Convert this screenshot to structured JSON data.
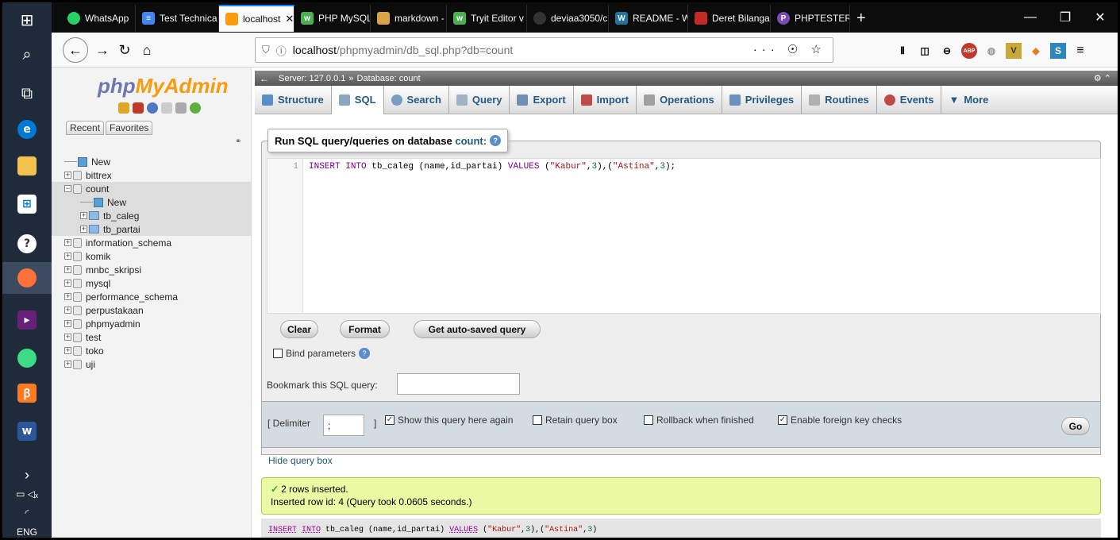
{
  "browser": {
    "tabs": [
      {
        "label": "WhatsApp",
        "icon": "whatsapp-icon",
        "color": "#25d366"
      },
      {
        "label": "Test Technica",
        "icon": "docs-icon",
        "color": "#4285f4"
      },
      {
        "label": "localhost",
        "icon": "phpmyadmin-icon",
        "color": "#f89c0e",
        "close": "✕"
      },
      {
        "label": "PHP MySQL",
        "icon": "w3schools-icon",
        "color": "#4caf50"
      },
      {
        "label": "markdown -",
        "icon": "document-icon",
        "color": "#d9a441"
      },
      {
        "label": "Tryit Editor v",
        "icon": "w3schools-icon",
        "color": "#4caf50"
      },
      {
        "label": "deviaa3050/c",
        "icon": "github-icon",
        "color": "#333333"
      },
      {
        "label": "README - W",
        "icon": "wordpress-icon",
        "color": "#21759b"
      },
      {
        "label": "Deret Bilanga",
        "icon": "site-icon",
        "color": "#c62828"
      },
      {
        "label": "PHPTESTER",
        "icon": "phptester-icon",
        "color": "#7b4bb5"
      }
    ],
    "new_tab": "+",
    "url_host": "localhost",
    "url_path": "/phpmyadmin/db_sql.php?db=count",
    "url_actions": "··· ☉ ☆",
    "window_controls": [
      "—",
      "❐",
      "✕"
    ]
  },
  "taskbar": {
    "apps": [
      "windows-start-icon",
      "search-icon",
      "task-view-icon",
      "edge-icon",
      "file-explorer-icon",
      "store-icon",
      "postman-icon",
      "firefox-icon",
      "visual-studio-icon",
      "android-studio-icon",
      "xampp-icon",
      "word-icon"
    ],
    "tray": {
      "arrow": "›",
      "lang": "ENG"
    }
  },
  "sidebar": {
    "logo_main": "php",
    "logo_accent": "MyAdmin",
    "tabs": [
      "Recent",
      "Favorites"
    ],
    "tree": [
      {
        "label": "New",
        "type": "new",
        "level": 0
      },
      {
        "label": "bittrex",
        "type": "db",
        "level": 0
      },
      {
        "label": "count",
        "type": "db",
        "level": 0,
        "expanded": true
      },
      {
        "label": "New",
        "type": "new",
        "level": 1
      },
      {
        "label": "tb_caleg",
        "type": "table",
        "level": 1
      },
      {
        "label": "tb_partai",
        "type": "table",
        "level": 1
      },
      {
        "label": "information_schema",
        "type": "db",
        "level": 0
      },
      {
        "label": "komik",
        "type": "db",
        "level": 0
      },
      {
        "label": "mnbc_skripsi",
        "type": "db",
        "level": 0
      },
      {
        "label": "mysql",
        "type": "db",
        "level": 0
      },
      {
        "label": "performance_schema",
        "type": "db",
        "level": 0
      },
      {
        "label": "perpustakaan",
        "type": "db",
        "level": 0
      },
      {
        "label": "phpmyadmin",
        "type": "db",
        "level": 0
      },
      {
        "label": "test",
        "type": "db",
        "level": 0
      },
      {
        "label": "toko",
        "type": "db",
        "level": 0
      },
      {
        "label": "uji",
        "type": "db",
        "level": 0
      }
    ]
  },
  "breadcrumb": {
    "server": "Server: 127.0.0.1",
    "sep": "»",
    "database": "Database: count"
  },
  "menu": [
    {
      "label": "Structure",
      "icon": "structure-icon",
      "color": "#5b8ec9"
    },
    {
      "label": "SQL",
      "icon": "sql-icon",
      "color": "#8aa6c1"
    },
    {
      "label": "Search",
      "icon": "search-icon",
      "color": "#7a9cc0"
    },
    {
      "label": "Query",
      "icon": "query-icon",
      "color": "#9fb2c6"
    },
    {
      "label": "Export",
      "icon": "export-icon",
      "color": "#6f8fb5"
    },
    {
      "label": "Import",
      "icon": "import-icon",
      "color": "#c04a4a"
    },
    {
      "label": "Operations",
      "icon": "wrench-icon",
      "color": "#a0a0a0"
    },
    {
      "label": "Privileges",
      "icon": "privileges-icon",
      "color": "#6b8fbf"
    },
    {
      "label": "Routines",
      "icon": "routines-icon",
      "color": "#b0b0b0"
    },
    {
      "label": "Events",
      "icon": "clock-icon",
      "color": "#c04a4a"
    },
    {
      "label": "More",
      "icon": "chevron-down-icon",
      "color": "#235a81"
    }
  ],
  "query_box": {
    "legend_prefix": "Run SQL query/queries on database",
    "legend_db": "count:",
    "line_number": "1",
    "sql": "INSERT INTO tb_caleg (name,id_partai) VALUES (\"Kabur\",3),(\"Astina\",3);",
    "buttons": {
      "clear": "Clear",
      "format": "Format",
      "autosaved": "Get auto-saved query"
    },
    "bind_parameters": "Bind parameters",
    "bookmark_label": "Bookmark this SQL query:",
    "bookmark_value": ""
  },
  "options": {
    "delimiter_label": "[ Delimiter",
    "delimiter_value": ";",
    "delimiter_close": "]",
    "show_query": {
      "label": "Show this query here again",
      "checked": true
    },
    "retain_box": {
      "label": "Retain query box",
      "checked": false
    },
    "rollback": {
      "label": "Rollback when finished",
      "checked": false
    },
    "foreign_keys": {
      "label": "Enable foreign key checks",
      "checked": true
    },
    "go": "Go"
  },
  "hide_query_box": "Hide query box",
  "result": {
    "line1": "2 rows inserted.",
    "line2": "Inserted row id: 4 (Query took 0.0605 seconds.)",
    "sql_echo": "INSERT INTO tb_caleg (name,id_partai) VALUES (\"Kabur\",3),(\"Astina\",3)"
  }
}
